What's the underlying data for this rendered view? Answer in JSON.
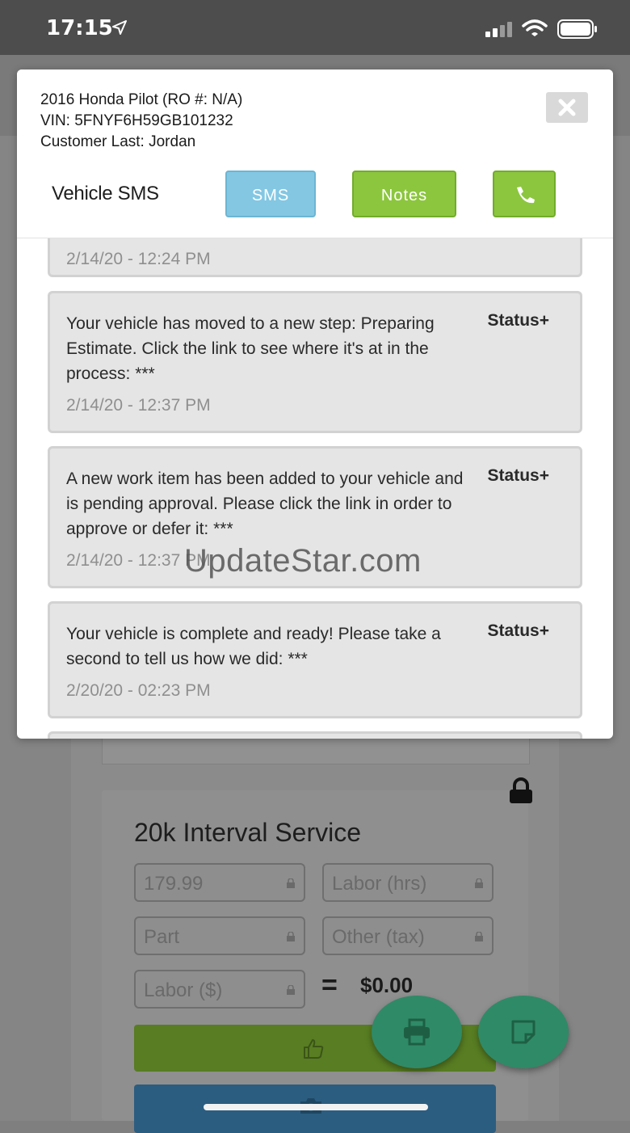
{
  "status_bar": {
    "time": "17:15"
  },
  "modal": {
    "vehicle_line": "2016 Honda Pilot (RO #: N/A)",
    "vin_line": "VIN: 5FNYF6H59GB101232",
    "customer_line": "Customer Last: Jordan",
    "title": "Vehicle SMS",
    "sms_label": "SMS",
    "notes_label": "Notes"
  },
  "messages": [
    {
      "text": "",
      "tag": "",
      "date": "2/14/20 - 12:24 PM"
    },
    {
      "text": "Your vehicle has moved to a new step: Preparing Estimate. Click the link to see where it's at in the process: ***",
      "tag": "Status+",
      "date": "2/14/20 - 12:37 PM"
    },
    {
      "text": "A new work item has been added to your vehicle and is pending approval. Please click the link in order to approve or defer it: ***",
      "tag": "Status+",
      "date": "2/14/20 - 12:37 PM"
    },
    {
      "text": "Your vehicle is complete and ready! Please take a second to tell us how we did: ***",
      "tag": "Status+",
      "date": "2/20/20 - 02:23 PM"
    }
  ],
  "service": {
    "title": "20k Interval Service",
    "fields": [
      {
        "value": "179.99"
      },
      {
        "placeholder": "Labor (hrs)"
      },
      {
        "placeholder": "Part"
      },
      {
        "placeholder": "Other (tax)"
      },
      {
        "placeholder": "Labor ($)"
      }
    ],
    "equals": "=",
    "total": "$0.00"
  },
  "watermark": "UpdateStar.com"
}
